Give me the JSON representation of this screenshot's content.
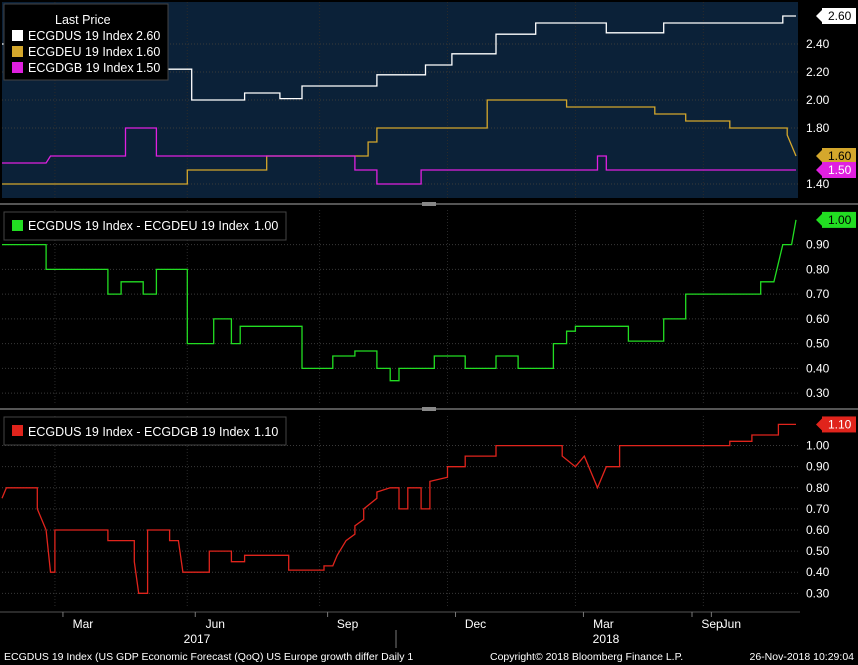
{
  "colors": {
    "background": "#000000",
    "panel_fill": "#0b2138",
    "grid": "#3a3a3a",
    "white_series": "#ffffff",
    "gold_series": "#d4a72c",
    "magenta_series": "#e020e0",
    "green_series": "#22dd22",
    "red_series": "#e0241c"
  },
  "chart_data": [
    {
      "type": "line",
      "legend_title": "Last Price",
      "legend": [
        {
          "name": "ECGDUS 19 Index",
          "last": "2.60",
          "color": "#ffffff"
        },
        {
          "name": "ECGDEU 19 Index",
          "last": "1.60",
          "color": "#d4a72c"
        },
        {
          "name": "ECGDGB 19 Index",
          "last": "1.50",
          "color": "#e020e0"
        }
      ],
      "last_badges": [
        "2.60",
        "1.60",
        "1.50"
      ],
      "ylim": [
        1.3,
        2.7
      ],
      "yticks": [
        "2.40",
        "2.20",
        "2.00",
        "1.80",
        "1.40"
      ],
      "series": [
        {
          "name": "ECGDUS 19 Index",
          "color": "#ffffff",
          "points": [
            [
              0,
              2.4
            ],
            [
              0.25,
              2.4
            ],
            [
              0.29,
              2.15
            ],
            [
              0.34,
              2.15
            ],
            [
              0.34,
              2.22
            ],
            [
              0.43,
              2.22
            ],
            [
              0.43,
              2.0
            ],
            [
              0.55,
              2.0
            ],
            [
              0.55,
              2.05
            ],
            [
              0.63,
              2.05
            ],
            [
              0.63,
              2.01
            ],
            [
              0.68,
              2.01
            ],
            [
              0.68,
              2.1
            ],
            [
              0.85,
              2.1
            ],
            [
              0.85,
              2.18
            ],
            [
              0.96,
              2.18
            ],
            [
              0.96,
              2.25
            ],
            [
              1.02,
              2.25
            ],
            [
              1.02,
              2.33
            ],
            [
              1.12,
              2.33
            ],
            [
              1.12,
              2.47
            ],
            [
              1.21,
              2.47
            ],
            [
              1.21,
              2.55
            ],
            [
              1.37,
              2.55
            ],
            [
              1.37,
              2.48
            ],
            [
              1.5,
              2.48
            ],
            [
              1.5,
              2.55
            ],
            [
              1.77,
              2.55
            ],
            [
              1.77,
              2.6
            ],
            [
              1.8,
              2.6
            ]
          ]
        },
        {
          "name": "ECGDEU 19 Index",
          "color": "#d4a72c",
          "points": [
            [
              0,
              1.4
            ],
            [
              0.42,
              1.4
            ],
            [
              0.42,
              1.5
            ],
            [
              0.6,
              1.5
            ],
            [
              0.6,
              1.6
            ],
            [
              0.83,
              1.6
            ],
            [
              0.83,
              1.7
            ],
            [
              0.85,
              1.7
            ],
            [
              0.85,
              1.8
            ],
            [
              1.1,
              1.8
            ],
            [
              1.1,
              2.0
            ],
            [
              1.28,
              2.0
            ],
            [
              1.28,
              1.95
            ],
            [
              1.48,
              1.95
            ],
            [
              1.48,
              1.9
            ],
            [
              1.55,
              1.9
            ],
            [
              1.55,
              1.85
            ],
            [
              1.65,
              1.85
            ],
            [
              1.65,
              1.8
            ],
            [
              1.78,
              1.8
            ],
            [
              1.78,
              1.75
            ],
            [
              1.8,
              1.6
            ]
          ]
        },
        {
          "name": "ECGDGB 19 Index",
          "color": "#e020e0",
          "points": [
            [
              0,
              1.55
            ],
            [
              0.1,
              1.55
            ],
            [
              0.11,
              1.6
            ],
            [
              0.28,
              1.6
            ],
            [
              0.28,
              1.8
            ],
            [
              0.35,
              1.8
            ],
            [
              0.35,
              1.6
            ],
            [
              0.8,
              1.6
            ],
            [
              0.8,
              1.5
            ],
            [
              0.85,
              1.5
            ],
            [
              0.85,
              1.4
            ],
            [
              0.95,
              1.4
            ],
            [
              0.95,
              1.5
            ],
            [
              1.35,
              1.5
            ],
            [
              1.35,
              1.6
            ],
            [
              1.37,
              1.6
            ],
            [
              1.37,
              1.5
            ],
            [
              1.8,
              1.5
            ]
          ]
        }
      ]
    },
    {
      "type": "line",
      "legend": [
        {
          "name": "ECGDUS 19 Index - ECGDEU 19 Index",
          "last": "1.00",
          "color": "#22dd22"
        }
      ],
      "last_badges": [
        "1.00"
      ],
      "ylim": [
        0.26,
        1.04
      ],
      "yticks": [
        "0.90",
        "0.80",
        "0.70",
        "0.60",
        "0.50",
        "0.40",
        "0.30"
      ],
      "series": [
        {
          "name": "ECGDUS 19 Index - ECGDEU 19 Index",
          "color": "#22dd22",
          "points": [
            [
              0,
              0.9
            ],
            [
              0.1,
              0.9
            ],
            [
              0.1,
              0.8
            ],
            [
              0.24,
              0.8
            ],
            [
              0.24,
              0.7
            ],
            [
              0.27,
              0.7
            ],
            [
              0.27,
              0.75
            ],
            [
              0.32,
              0.75
            ],
            [
              0.32,
              0.7
            ],
            [
              0.35,
              0.7
            ],
            [
              0.35,
              0.8
            ],
            [
              0.42,
              0.8
            ],
            [
              0.42,
              0.5
            ],
            [
              0.48,
              0.5
            ],
            [
              0.48,
              0.6
            ],
            [
              0.52,
              0.6
            ],
            [
              0.52,
              0.5
            ],
            [
              0.54,
              0.5
            ],
            [
              0.54,
              0.57
            ],
            [
              0.68,
              0.57
            ],
            [
              0.68,
              0.4
            ],
            [
              0.75,
              0.4
            ],
            [
              0.75,
              0.45
            ],
            [
              0.8,
              0.45
            ],
            [
              0.8,
              0.47
            ],
            [
              0.85,
              0.47
            ],
            [
              0.85,
              0.4
            ],
            [
              0.88,
              0.4
            ],
            [
              0.88,
              0.35
            ],
            [
              0.9,
              0.35
            ],
            [
              0.9,
              0.4
            ],
            [
              0.98,
              0.4
            ],
            [
              0.98,
              0.45
            ],
            [
              1.05,
              0.45
            ],
            [
              1.05,
              0.4
            ],
            [
              1.12,
              0.4
            ],
            [
              1.12,
              0.45
            ],
            [
              1.17,
              0.45
            ],
            [
              1.17,
              0.4
            ],
            [
              1.25,
              0.4
            ],
            [
              1.25,
              0.5
            ],
            [
              1.28,
              0.5
            ],
            [
              1.28,
              0.55
            ],
            [
              1.3,
              0.55
            ],
            [
              1.3,
              0.57
            ],
            [
              1.42,
              0.57
            ],
            [
              1.42,
              0.51
            ],
            [
              1.5,
              0.51
            ],
            [
              1.5,
              0.6
            ],
            [
              1.55,
              0.6
            ],
            [
              1.55,
              0.7
            ],
            [
              1.72,
              0.7
            ],
            [
              1.72,
              0.75
            ],
            [
              1.75,
              0.75
            ],
            [
              1.77,
              0.9
            ],
            [
              1.79,
              0.9
            ],
            [
              1.8,
              1.0
            ]
          ]
        }
      ]
    },
    {
      "type": "line",
      "legend": [
        {
          "name": "ECGDUS 19 Index - ECGDGB 19 Index",
          "last": "1.10",
          "color": "#e0241c"
        }
      ],
      "last_badges": [
        "1.10"
      ],
      "ylim": [
        0.24,
        1.14
      ],
      "yticks": [
        "1.00",
        "0.90",
        "0.80",
        "0.70",
        "0.60",
        "0.50",
        "0.40",
        "0.30"
      ],
      "series": [
        {
          "name": "ECGDUS 19 Index - ECGDGB 19 Index",
          "color": "#e0241c",
          "points": [
            [
              0,
              0.75
            ],
            [
              0.01,
              0.8
            ],
            [
              0.08,
              0.8
            ],
            [
              0.08,
              0.7
            ],
            [
              0.1,
              0.6
            ],
            [
              0.11,
              0.4
            ],
            [
              0.12,
              0.4
            ],
            [
              0.12,
              0.6
            ],
            [
              0.24,
              0.6
            ],
            [
              0.24,
              0.55
            ],
            [
              0.3,
              0.55
            ],
            [
              0.3,
              0.45
            ],
            [
              0.31,
              0.3
            ],
            [
              0.33,
              0.3
            ],
            [
              0.33,
              0.6
            ],
            [
              0.38,
              0.6
            ],
            [
              0.38,
              0.55
            ],
            [
              0.4,
              0.55
            ],
            [
              0.41,
              0.4
            ],
            [
              0.47,
              0.4
            ],
            [
              0.47,
              0.5
            ],
            [
              0.52,
              0.5
            ],
            [
              0.52,
              0.45
            ],
            [
              0.55,
              0.45
            ],
            [
              0.55,
              0.48
            ],
            [
              0.65,
              0.48
            ],
            [
              0.65,
              0.41
            ],
            [
              0.73,
              0.41
            ],
            [
              0.73,
              0.43
            ],
            [
              0.75,
              0.43
            ],
            [
              0.76,
              0.48
            ],
            [
              0.78,
              0.55
            ],
            [
              0.8,
              0.58
            ],
            [
              0.8,
              0.62
            ],
            [
              0.82,
              0.65
            ],
            [
              0.82,
              0.7
            ],
            [
              0.85,
              0.75
            ],
            [
              0.85,
              0.78
            ],
            [
              0.88,
              0.8
            ],
            [
              0.9,
              0.8
            ],
            [
              0.9,
              0.7
            ],
            [
              0.92,
              0.7
            ],
            [
              0.92,
              0.8
            ],
            [
              0.95,
              0.8
            ],
            [
              0.95,
              0.7
            ],
            [
              0.97,
              0.7
            ],
            [
              0.97,
              0.83
            ],
            [
              1.01,
              0.85
            ],
            [
              1.01,
              0.9
            ],
            [
              1.05,
              0.9
            ],
            [
              1.05,
              0.95
            ],
            [
              1.12,
              0.95
            ],
            [
              1.12,
              1.0
            ],
            [
              1.27,
              1.0
            ],
            [
              1.27,
              0.95
            ],
            [
              1.3,
              0.9
            ],
            [
              1.32,
              0.95
            ],
            [
              1.35,
              0.8
            ],
            [
              1.37,
              0.9
            ],
            [
              1.4,
              0.9
            ],
            [
              1.4,
              1.0
            ],
            [
              1.65,
              1.0
            ],
            [
              1.65,
              1.02
            ],
            [
              1.7,
              1.02
            ],
            [
              1.7,
              1.05
            ],
            [
              1.76,
              1.05
            ],
            [
              1.76,
              1.1
            ],
            [
              1.8,
              1.1
            ]
          ]
        }
      ]
    }
  ],
  "x_axis": {
    "months": [
      "Mar",
      "Jun",
      "Sep",
      "Dec",
      "Mar",
      "Jun",
      "Sep"
    ],
    "years": [
      "2017",
      "2018"
    ]
  },
  "footer": {
    "left": "ECGDUS 19 Index (US GDP Economic Forecast (QoQ) US Europe growth differ  Daily 1",
    "center": "Copyright© 2018 Bloomberg Finance L.P.",
    "right": "26-Nov-2018 10:29:04"
  }
}
